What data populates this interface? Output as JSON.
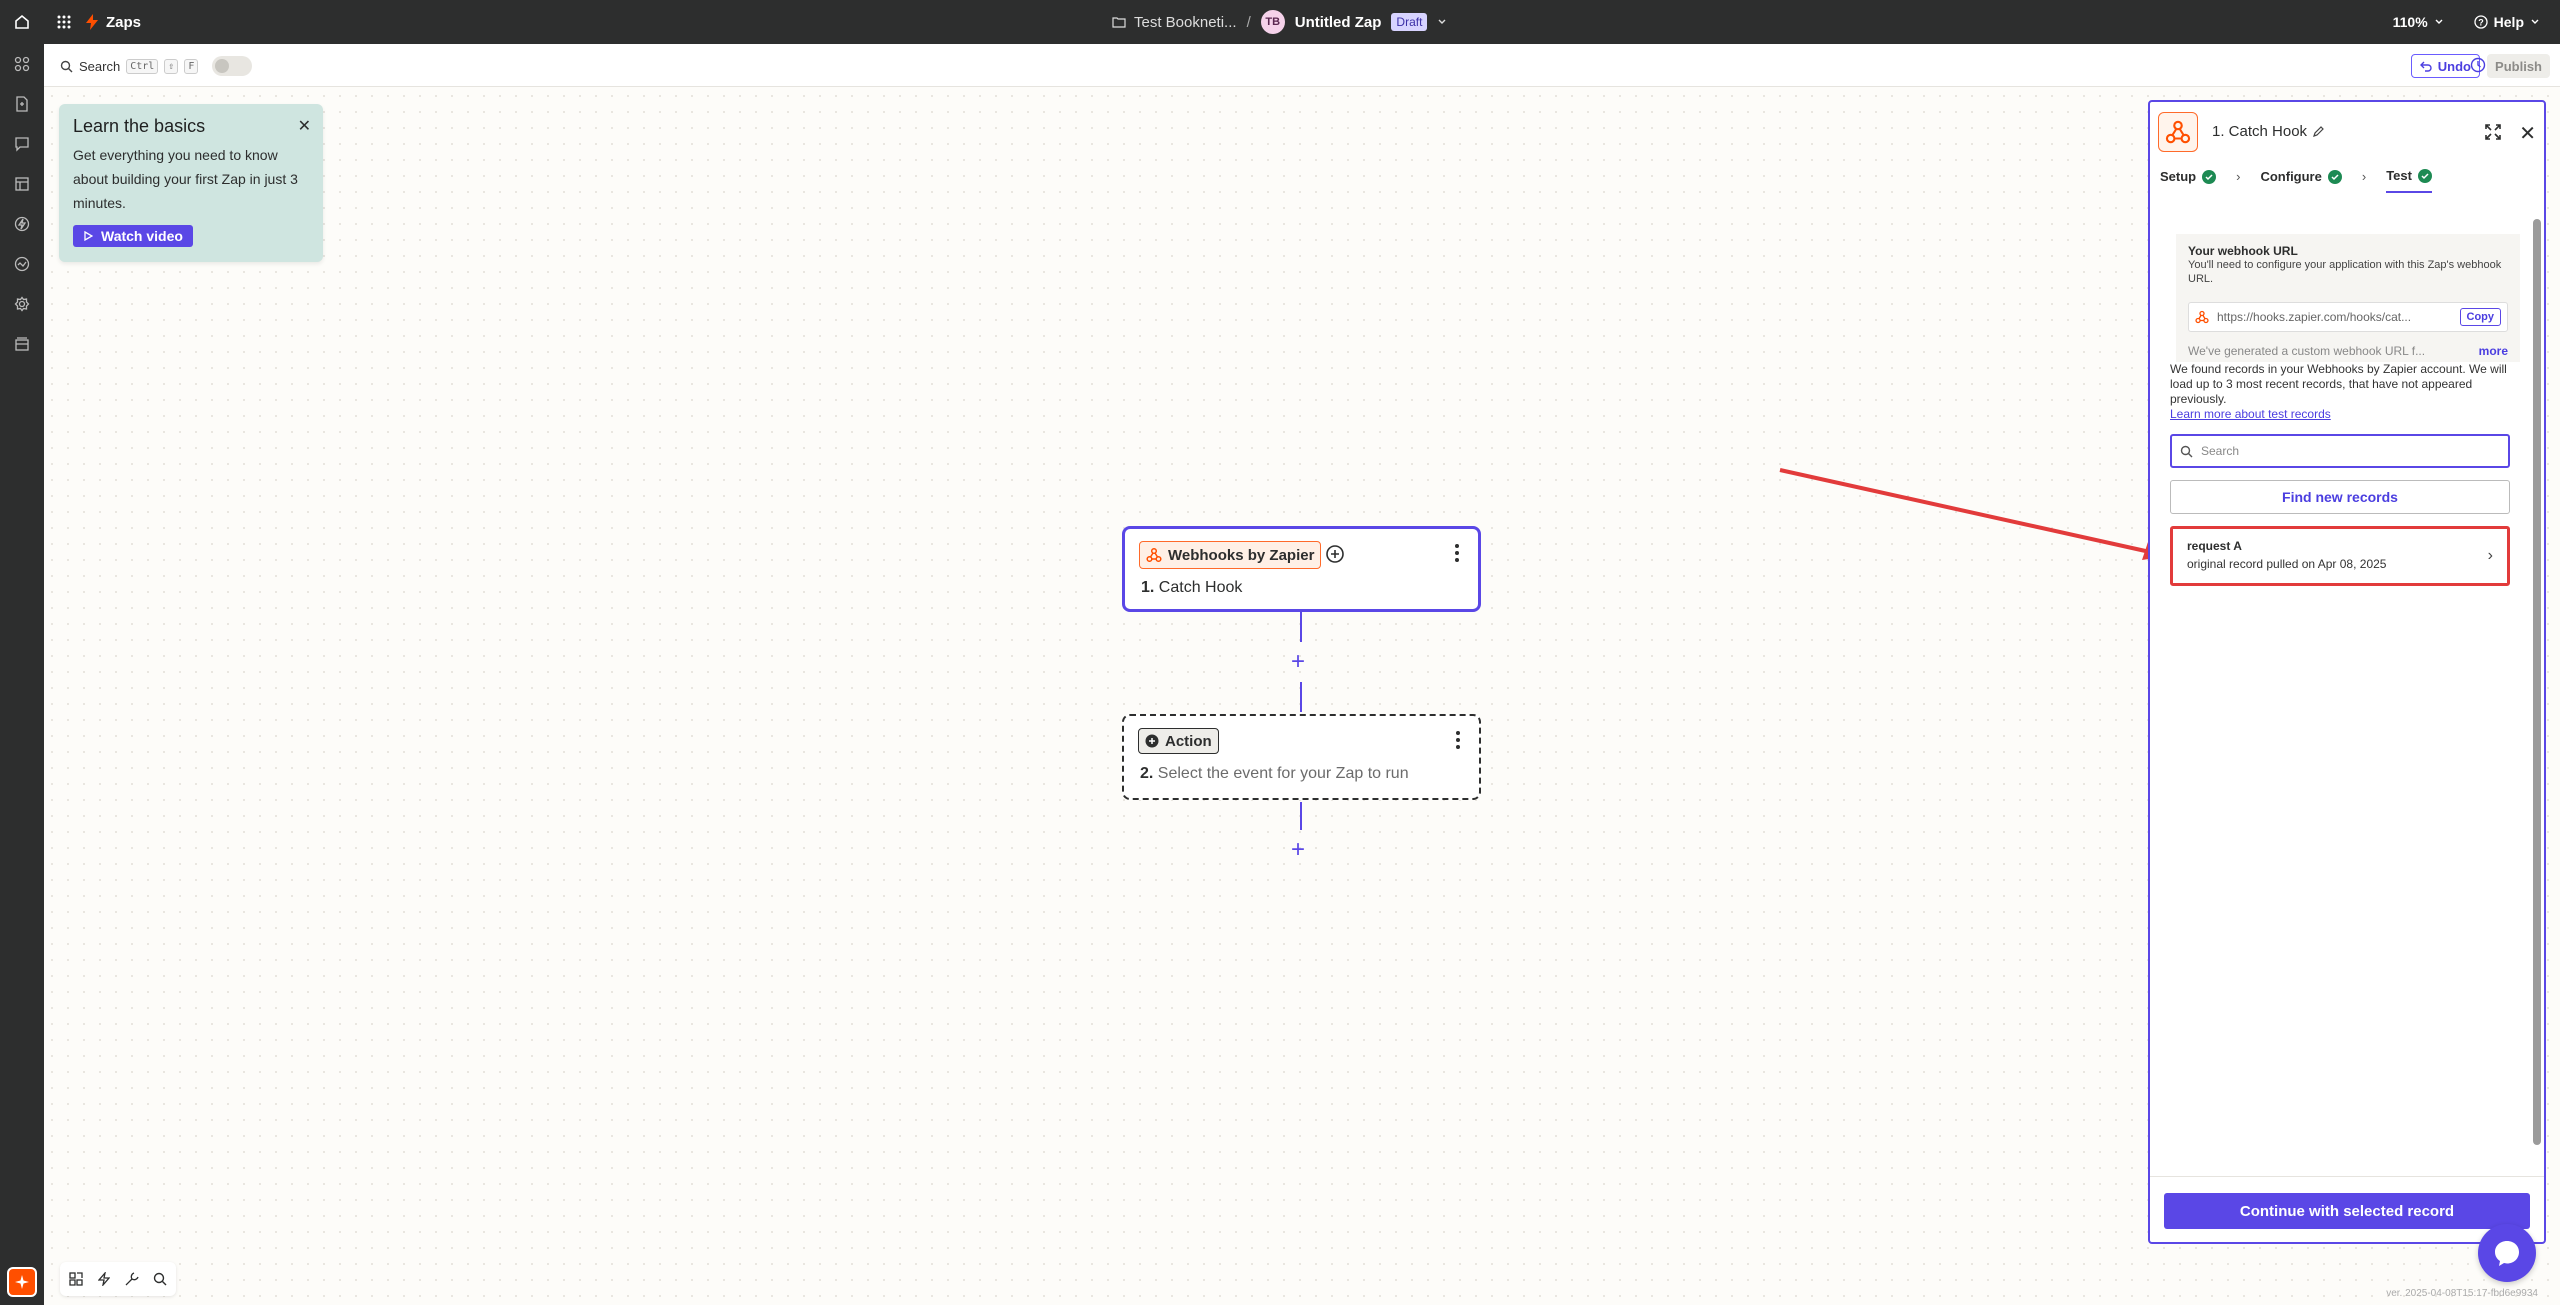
{
  "topbar": {
    "app_label": "Zaps",
    "folder": "Test Bookneti...",
    "separator": "/",
    "avatar_initials": "TB",
    "zap_name": "Untitled Zap",
    "status_badge": "Draft",
    "zoom": "110%",
    "help": "Help"
  },
  "subbar": {
    "search_label": "Search",
    "shortcut_keys": [
      "Ctrl",
      "⇧",
      "F"
    ],
    "undo_label": "Undo",
    "publish_label": "Publish"
  },
  "learn": {
    "title": "Learn the basics",
    "body": "Get everything you need to know about building your first Zap in just 3 minutes.",
    "button": "Watch video"
  },
  "step1": {
    "app": "Webhooks by Zapier",
    "number": "1.",
    "title": "Catch Hook"
  },
  "step2": {
    "chip": "Action",
    "number": "2.",
    "title": "Select the event for your Zap to run"
  },
  "panel": {
    "title": "1. Catch Hook",
    "tabs": [
      {
        "label": "Setup",
        "complete": true
      },
      {
        "label": "Configure",
        "complete": true
      },
      {
        "label": "Test",
        "complete": true,
        "active": true
      }
    ],
    "webhook_heading": "Your webhook URL",
    "webhook_desc": "You'll need to configure your application with this Zap's webhook URL.",
    "webhook_url": "https://hooks.zapier.com/hooks/cat...",
    "copy_label": "Copy",
    "generated_text": "We've generated a custom webhook URL f...",
    "more_label": "more",
    "found_text": "We found records in your Webhooks by Zapier account. We will load up to 3 most recent records, that have not appeared previously.",
    "learn_link": "Learn more about test records",
    "search_placeholder": "Search",
    "find_button": "Find new records",
    "record_title": "request A",
    "record_sub": "original record pulled on Apr 08, 2025",
    "continue_button": "Continue with selected record"
  },
  "version": "ver. 2025-04-08T15:17-fbd6e9934",
  "colors": {
    "brand_orange": "#ff4f00",
    "accent_purple": "#5a47e6",
    "annotation_red": "#e23b3b",
    "success_green": "#1d8a53"
  }
}
